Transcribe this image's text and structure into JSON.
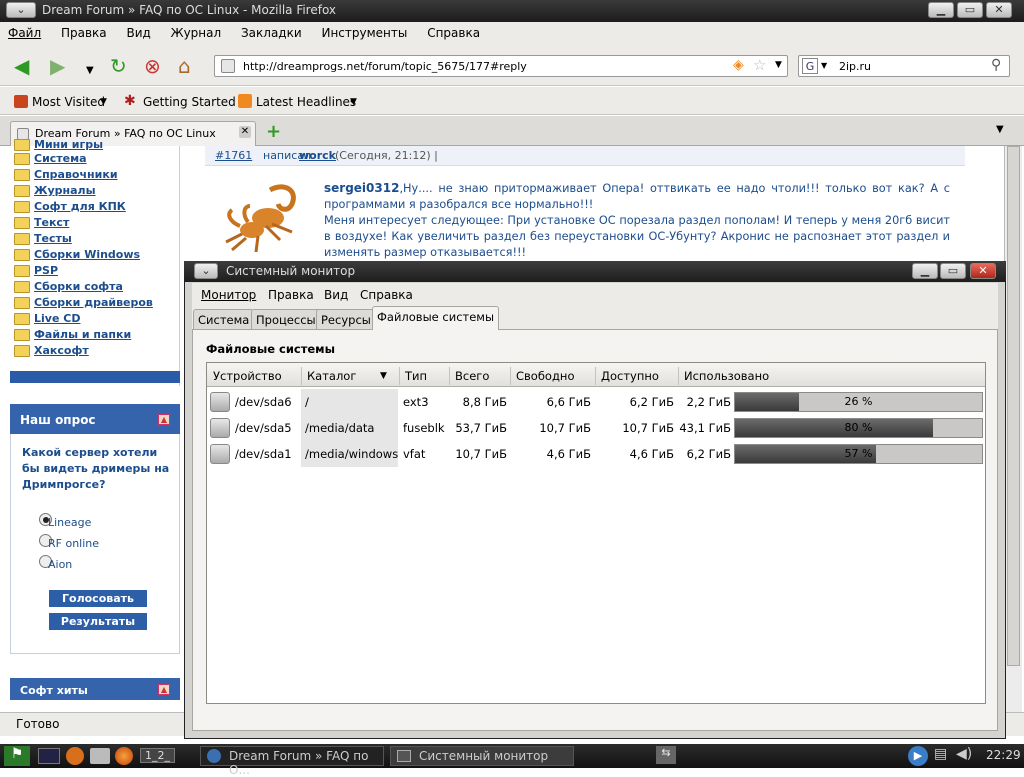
{
  "firefox": {
    "title": "Dream Forum » FAQ по ОС Linux - Mozilla Firefox",
    "menu": [
      "Файл",
      "Правка",
      "Вид",
      "Журнал",
      "Закладки",
      "Инструменты",
      "Справка"
    ],
    "url": "http://dreamprogs.net/forum/topic_5675/177#reply",
    "search_engine_icon": "google-icon",
    "search_value": "2ip.ru",
    "bookmarks": [
      "Most Visited",
      "Getting Started",
      "Latest Headlines"
    ],
    "tab_title": "Dream Forum » FAQ по ОС Linux",
    "status": "Готово"
  },
  "sidebar": {
    "items": [
      "Мини игры",
      "Система",
      "Справочники",
      "Журналы",
      "Софт для КПК",
      "Текст",
      "Тесты",
      "Сборки Windows",
      "PSP",
      "Сборки софта",
      "Сборки драйверов",
      "Live CD",
      "Файлы и папки",
      "Хаксофт"
    ]
  },
  "poll": {
    "title": "Наш опрос",
    "question": "Какой сервер хотели бы видеть дримеры на Дримпрогсе?",
    "options": [
      "Lineage",
      "RF online",
      "Aion"
    ],
    "selected": "Lineage",
    "vote_label": "Голосовать",
    "results_label": "Результаты"
  },
  "hits": {
    "title": "Софт хиты"
  },
  "post": {
    "number": "#1761",
    "wrote": "написал:",
    "author": "worck",
    "time": "(Сегодня, 21:12) |",
    "user": "sergei0312",
    "text1": ",Ну.... не знаю притормаживает Опера! оттвикать ее надо чтоли!!! только вот как? А с программами я разобрался все нормально!!!",
    "text2": "Меня интересует следующее: При установке ОС порезала раздел пополам! И теперь у меня 20гб висит в воздухе! Как увеличить раздел без переустановки ОС-Убунту? Акронис не распознает этот раздел и изменять размер отказывается!!!"
  },
  "sysmon": {
    "title": "Системный монитор",
    "menu": [
      "Монитор",
      "Правка",
      "Вид",
      "Справка"
    ],
    "tabs": [
      "Система",
      "Процессы",
      "Ресурсы",
      "Файловые системы"
    ],
    "active_tab": "Файловые системы",
    "section_title": "Файловые системы",
    "columns": [
      "Устройство",
      "Каталог",
      "Тип",
      "Всего",
      "Свободно",
      "Доступно",
      "Использовано"
    ],
    "rows": [
      {
        "device": "/dev/sda6",
        "dir": "/",
        "type": "ext3",
        "total": "8,8 ГиБ",
        "free": "6,6 ГиБ",
        "avail": "6,2 ГиБ",
        "used": "2,2 ГиБ",
        "pct": "26 %",
        "fraction": 0.26
      },
      {
        "device": "/dev/sda5",
        "dir": "/media/data",
        "type": "fuseblk",
        "total": "53,7 ГиБ",
        "free": "10,7 ГиБ",
        "avail": "10,7 ГиБ",
        "used": "43,1 ГиБ",
        "pct": "80 %",
        "fraction": 0.8
      },
      {
        "device": "/dev/sda1",
        "dir": "/media/windows",
        "type": "vfat",
        "total": "10,7 ГиБ",
        "free": "4,6 ГиБ",
        "avail": "4,6 ГиБ",
        "used": "6,2 ГиБ",
        "pct": "57 %",
        "fraction": 0.57
      }
    ]
  },
  "taskbar": {
    "workspaces": "1_2_",
    "tasks": [
      "Dream Forum » FAQ по О...",
      "Системный монитор"
    ],
    "clock": "22:29"
  }
}
